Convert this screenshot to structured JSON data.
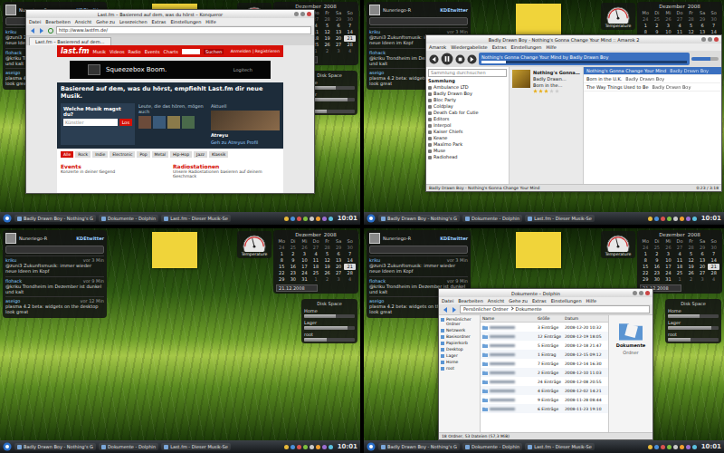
{
  "widgets": {
    "microblog": {
      "user": "Nuneriego-R",
      "brand": "KDEtwitter",
      "posts": [
        {
          "user": "kriku",
          "time": "vor 3 Min",
          "text": "@zuni3 Zukunftsmusik: immer wieder neue Ideen im Kopf"
        },
        {
          "user": "flohack",
          "time": "vor 9 Min",
          "text": "@kriku Trondheim im Dezember ist dunkel und kalt"
        },
        {
          "user": "aseigo",
          "time": "vor 12 Min",
          "text": "plasma 4.2 beta: widgets on the desktop look great"
        }
      ]
    },
    "calendar": {
      "month": "Dezember",
      "year": "2008",
      "weekdays": [
        "Mo",
        "Di",
        "Mi",
        "Do",
        "Fr",
        "Sa",
        "So"
      ],
      "weeks": [
        [
          {
            "d": "24",
            "dim": true,
            "selected": false
          },
          {
            "d": "25",
            "dim": true,
            "selected": false
          },
          {
            "d": "26",
            "dim": true,
            "selected": false
          },
          {
            "d": "27",
            "dim": true,
            "selected": false
          },
          {
            "d": "28",
            "dim": true,
            "selected": false
          },
          {
            "d": "29",
            "dim": true,
            "selected": false
          },
          {
            "d": "30",
            "dim": true,
            "selected": false
          }
        ],
        [
          {
            "d": "1",
            "dim": false,
            "selected": false
          },
          {
            "d": "2",
            "dim": false,
            "selected": false
          },
          {
            "d": "3",
            "dim": false,
            "selected": false
          },
          {
            "d": "4",
            "dim": false,
            "selected": false
          },
          {
            "d": "5",
            "dim": false,
            "selected": false
          },
          {
            "d": "6",
            "dim": false,
            "selected": false
          },
          {
            "d": "7",
            "dim": false,
            "selected": false
          }
        ],
        [
          {
            "d": "8",
            "dim": false,
            "selected": false
          },
          {
            "d": "9",
            "dim": false,
            "selected": false
          },
          {
            "d": "10",
            "dim": false,
            "selected": false
          },
          {
            "d": "11",
            "dim": false,
            "selected": false
          },
          {
            "d": "12",
            "dim": false,
            "selected": false
          },
          {
            "d": "13",
            "dim": false,
            "selected": false
          },
          {
            "d": "14",
            "dim": false,
            "selected": false
          }
        ],
        [
          {
            "d": "15",
            "dim": false,
            "selected": false
          },
          {
            "d": "16",
            "dim": false,
            "selected": false
          },
          {
            "d": "17",
            "dim": false,
            "selected": false
          },
          {
            "d": "18",
            "dim": false,
            "selected": false
          },
          {
            "d": "19",
            "dim": false,
            "selected": false
          },
          {
            "d": "20",
            "dim": false,
            "selected": false
          },
          {
            "d": "21",
            "dim": false,
            "selected": true
          }
        ],
        [
          {
            "d": "22",
            "dim": false,
            "selected": false
          },
          {
            "d": "23",
            "dim": false,
            "selected": false
          },
          {
            "d": "24",
            "dim": false,
            "selected": false
          },
          {
            "d": "25",
            "dim": false,
            "selected": false
          },
          {
            "d": "26",
            "dim": false,
            "selected": false
          },
          {
            "d": "27",
            "dim": false,
            "selected": false
          },
          {
            "d": "28",
            "dim": false,
            "selected": false
          }
        ],
        [
          {
            "d": "29",
            "dim": false,
            "selected": false
          },
          {
            "d": "30",
            "dim": false,
            "selected": false
          },
          {
            "d": "31",
            "dim": false,
            "selected": false
          },
          {
            "d": "1",
            "dim": true,
            "selected": false
          },
          {
            "d": "2",
            "dim": true,
            "selected": false
          },
          {
            "d": "3",
            "dim": true,
            "selected": false
          },
          {
            "d": "4",
            "dim": true,
            "selected": false
          }
        ]
      ],
      "date": "21.12.2008"
    },
    "gauge": {
      "title": "Temperature",
      "level": 0.42
    },
    "disk": {
      "title": "Disk Space",
      "items": [
        {
          "name": "Home",
          "level": 0.62
        },
        {
          "name": "Lager",
          "level": 0.85
        },
        {
          "name": "root",
          "level": 0.45
        }
      ]
    }
  },
  "panel": {
    "tasks": [
      "Badly Drawn Boy - Nothing's G",
      "Dokumente - Dolphin",
      "Last.fm - Dieser Musik-Se"
    ],
    "clock": "10:01"
  },
  "desktops": [
    {
      "window": {
        "kind": "browser",
        "title": "Last.fm – Basierend auf dem, was du hörst – Konqueror",
        "menu": [
          "Datei",
          "Bearbeiten",
          "Ansicht",
          "Gehe zu",
          "Lesezeichen",
          "Extras",
          "Einstellungen",
          "Hilfe"
        ],
        "url": "http://www.lastfm.de/",
        "tab": "Last.fm – Basierend auf dem…",
        "page": {
          "logo": "last.fm",
          "nav": [
            "Musik",
            "Videos",
            "Radio",
            "Events",
            "Charts"
          ],
          "search_button": "Suchen",
          "account": "Anmelden | Registrieren",
          "ad": "Squeezebox Boom.",
          "ad_brand": "Logitech",
          "headline": "Basierend auf dem, was du hörst, empfiehlt Last.fm dir neue Musik.",
          "question": "Welche Musik magst du?",
          "input": "Künstler",
          "go": "Los",
          "people_title": "Leute, die das hören, mögen auch",
          "feature_title": "Aktuell",
          "feature_caption": "Atreyu",
          "feature_link": "Geh zu Atreyus Profil",
          "genres": [
            {
              "label": "Alle",
              "selected": true
            },
            {
              "label": "Rock",
              "selected": false
            },
            {
              "label": "Indie",
              "selected": false
            },
            {
              "label": "Electronic",
              "selected": false
            },
            {
              "label": "Pop",
              "selected": false
            },
            {
              "label": "Metal",
              "selected": false
            },
            {
              "label": "Hip-Hop",
              "selected": false
            },
            {
              "label": "Jazz",
              "selected": false
            },
            {
              "label": "Klassik",
              "selected": false
            }
          ],
          "columns": [
            {
              "title": "Events",
              "text": "Konzerte in deiner Gegend"
            },
            {
              "title": "Radiostationen",
              "text": "Unsere Radiostationen basieren auf deinem Geschmack"
            }
          ]
        }
      }
    },
    {
      "window": {
        "kind": "player",
        "title": "Badly Drawn Boy - Nothing's Gonna Change Your Mind :: Amarok 2",
        "menu": [
          "Amarok",
          "Wiedergabeliste",
          "Extras",
          "Einstellungen",
          "Hilfe"
        ],
        "now_playing": "Nothing's Gonna Change Your Mind by Badly Drawn Boy",
        "progress": 0.12,
        "volume": 0.7,
        "search_placeholder": "Sammlung durchsuchen",
        "collection_title": "Sammlung",
        "collection": [
          "Ambulance LTD",
          "Badly Drawn Boy",
          "Bloc Party",
          "Coldplay",
          "Death Cab for Cutie",
          "Editors",
          "Interpol",
          "Kaiser Chiefs",
          "Keane",
          "Maxïmo Park",
          "Muse",
          "Radiohead"
        ],
        "context": {
          "track": "Nothing's Gonna…",
          "artist": "Badly Drawn…",
          "album": "Born in the…",
          "stars": 3
        },
        "playlist": [
          {
            "title": "Nothing's Gonna Change Your Mind",
            "artist": "Badly Drawn Boy",
            "selected": true
          },
          {
            "title": "Born in the U.K.",
            "artist": "Badly Drawn Boy",
            "selected": false
          },
          {
            "title": "The Way Things Used to Be",
            "artist": "Badly Drawn Boy",
            "selected": false
          }
        ],
        "status": "Badly Drawn Boy - Nothing's Gonna Change Your Mind",
        "time": "0:23 / 3:18"
      }
    },
    {
      "window": null
    },
    {
      "window": {
        "kind": "filemanager",
        "title": "Dokumente – Dolphin",
        "menu": [
          "Datei",
          "Bearbeiten",
          "Ansicht",
          "Gehe zu",
          "Extras",
          "Einstellungen",
          "Hilfe"
        ],
        "breadcrumb": [
          "Persönlicher Ordner",
          "Dokumente"
        ],
        "places": [
          "Persönlicher Ordner",
          "Netzwerk",
          "Basisordner",
          "Papierkorb",
          "Desktop",
          "Lager",
          "Home",
          "root"
        ],
        "columns": [
          "Name",
          "Größe",
          "Datum"
        ],
        "rows": [
          {
            "size": "3 Einträge",
            "date": "2008-12-20 10:32",
            "selected": false
          },
          {
            "size": "12 Einträge",
            "date": "2008-12-19 18:05",
            "selected": false
          },
          {
            "size": "5 Einträge",
            "date": "2008-12-18 21:47",
            "selected": false
          },
          {
            "size": "1 Eintrag",
            "date": "2008-12-15 09:12",
            "selected": false
          },
          {
            "size": "7 Einträge",
            "date": "2008-12-14 16:30",
            "selected": false
          },
          {
            "size": "2 Einträge",
            "date": "2008-12-10 11:03",
            "selected": false
          },
          {
            "size": "24 Einträge",
            "date": "2008-12-08 20:55",
            "selected": false
          },
          {
            "size": "4 Einträge",
            "date": "2008-12-02 14:21",
            "selected": false
          },
          {
            "size": "9 Einträge",
            "date": "2008-11-28 08:44",
            "selected": false
          },
          {
            "size": "6 Einträge",
            "date": "2008-11-23 19:10",
            "selected": false
          }
        ],
        "info": {
          "title": "Dokumente",
          "type": "Ordner"
        },
        "status": "18 Ordner, 53 Dateien (57,3 MiB)"
      }
    }
  ]
}
